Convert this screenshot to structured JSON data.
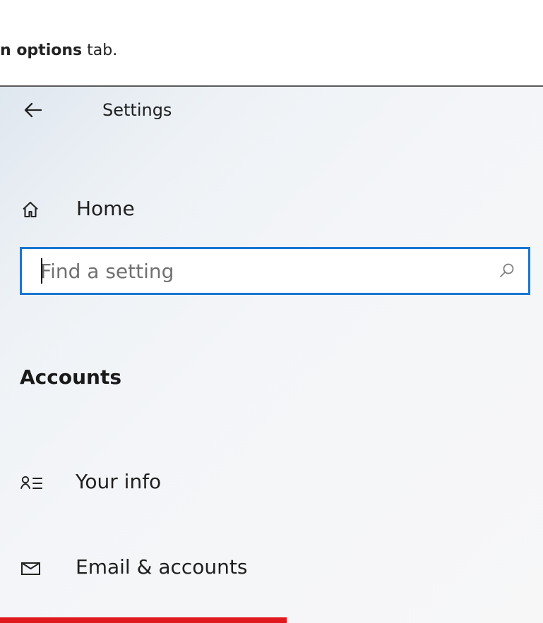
{
  "caption": {
    "bold_fragment": "n options",
    "suffix": " tab."
  },
  "window": {
    "title": "Settings"
  },
  "home": {
    "label": "Home"
  },
  "search": {
    "placeholder": "Find a setting",
    "value": ""
  },
  "section": {
    "title": "Accounts"
  },
  "nav": {
    "items": [
      {
        "label": "Your info",
        "icon": "your-info-icon"
      },
      {
        "label": "Email & accounts",
        "icon": "mail-icon"
      }
    ]
  },
  "colors": {
    "accent": "#1976d2",
    "highlight": "#e0191e",
    "panel_bg": "#f3f5f8"
  }
}
